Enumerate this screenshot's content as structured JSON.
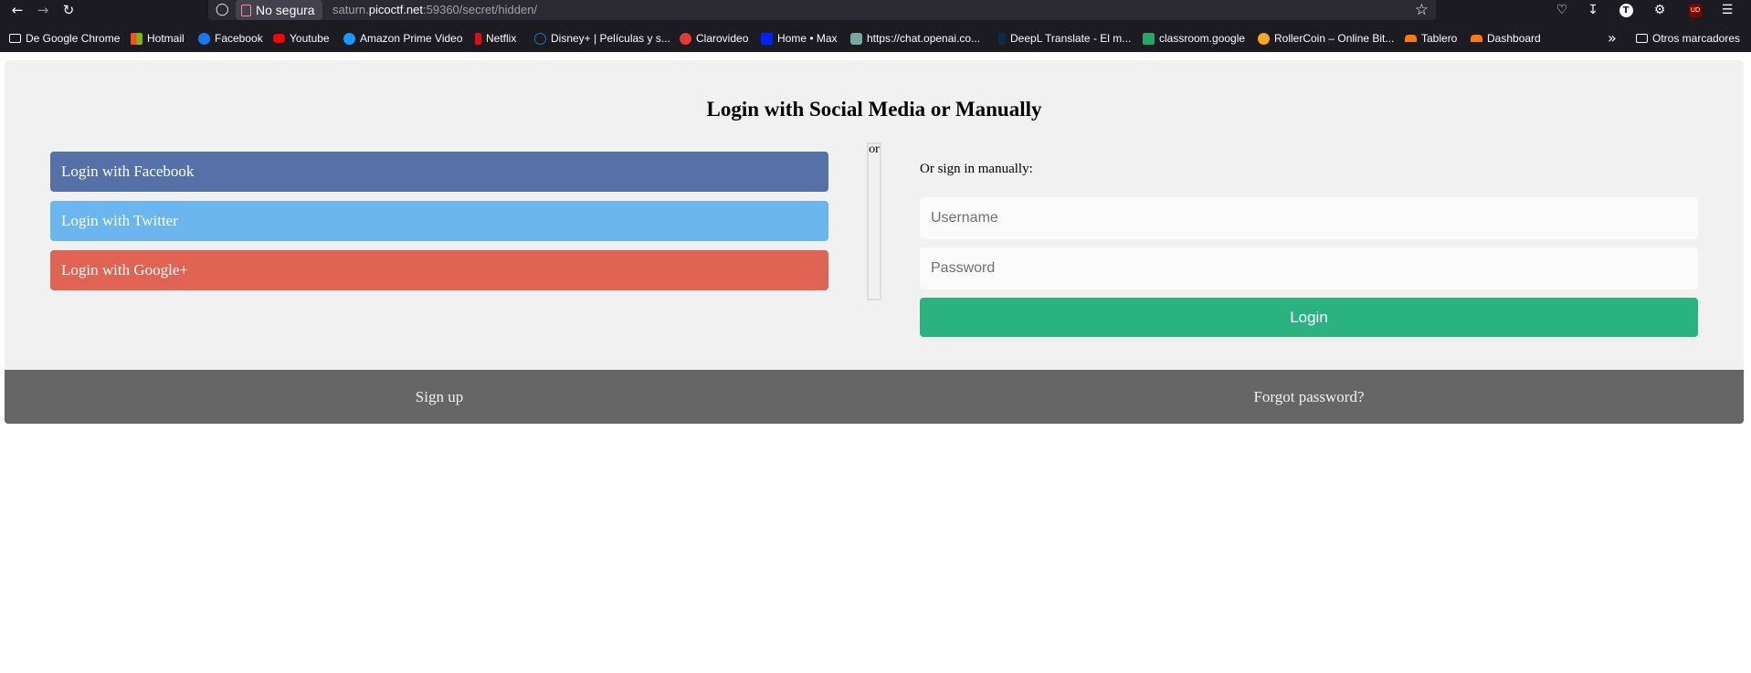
{
  "browser": {
    "security_label": "No segura",
    "url_host": "saturn.picoctf.net",
    "url_scheme_prefix": "",
    "url_prefix": "saturn.",
    "url_domain": "picoctf.net",
    "url_rest": ":59360/secret/hidden/",
    "profile_initial": "T",
    "ublock_label": "UD"
  },
  "bookmarks": {
    "items": [
      {
        "label": "De Google Chrome",
        "icon": "folder-icon",
        "color": "#fbfbfe"
      },
      {
        "label": "Hotmail",
        "icon": "microsoft-icon",
        "color": "#f25022"
      },
      {
        "label": "Facebook",
        "icon": "facebook-icon",
        "color": "#1877f2"
      },
      {
        "label": "Youtube",
        "icon": "youtube-icon",
        "color": "#ff0000"
      },
      {
        "label": "Amazon Prime Video",
        "icon": "prime-video-icon",
        "color": "#1a98ff"
      },
      {
        "label": "Netflix",
        "icon": "netflix-icon",
        "color": "#e50914"
      },
      {
        "label": "Disney+ | Películas y s...",
        "icon": "disney-icon",
        "color": "#1c4b9c"
      },
      {
        "label": "Clarovideo",
        "icon": "clarovideo-icon",
        "color": "#e53935"
      },
      {
        "label": "Home • Max",
        "icon": "max-icon",
        "color": "#0021ff"
      },
      {
        "label": "https://chat.openai.co...",
        "icon": "openai-icon",
        "color": "#74aa9c"
      },
      {
        "label": "DeepL Translate - El m...",
        "icon": "deepl-icon",
        "color": "#0f2b46"
      },
      {
        "label": "classroom.google",
        "icon": "classroom-icon",
        "color": "#25a667"
      },
      {
        "label": "RollerCoin – Online Bit...",
        "icon": "rollercoin-icon",
        "color": "#f5a623"
      },
      {
        "label": "Tablero",
        "icon": "tablero-icon",
        "color": "#ff7a00"
      },
      {
        "label": "Dashboard",
        "icon": "dashboard-icon",
        "color": "#ff7a00"
      }
    ],
    "other_label": "Otros marcadores"
  },
  "page": {
    "title": "Login with Social Media or Manually",
    "facebook_label": "Login with Facebook",
    "twitter_label": "Login with Twitter",
    "google_label": "Login with Google+",
    "or_label": "or",
    "manual_hint": "Or sign in manually:",
    "username_placeholder": "Username",
    "password_placeholder": "Password",
    "login_label": "Login",
    "signup_label": "Sign up",
    "forgot_label": "Forgot password?"
  },
  "colors": {
    "facebook": "#5571a8",
    "twitter": "#6bb6ee",
    "google": "#e06454",
    "login": "#2ab380",
    "footer": "#666666"
  }
}
